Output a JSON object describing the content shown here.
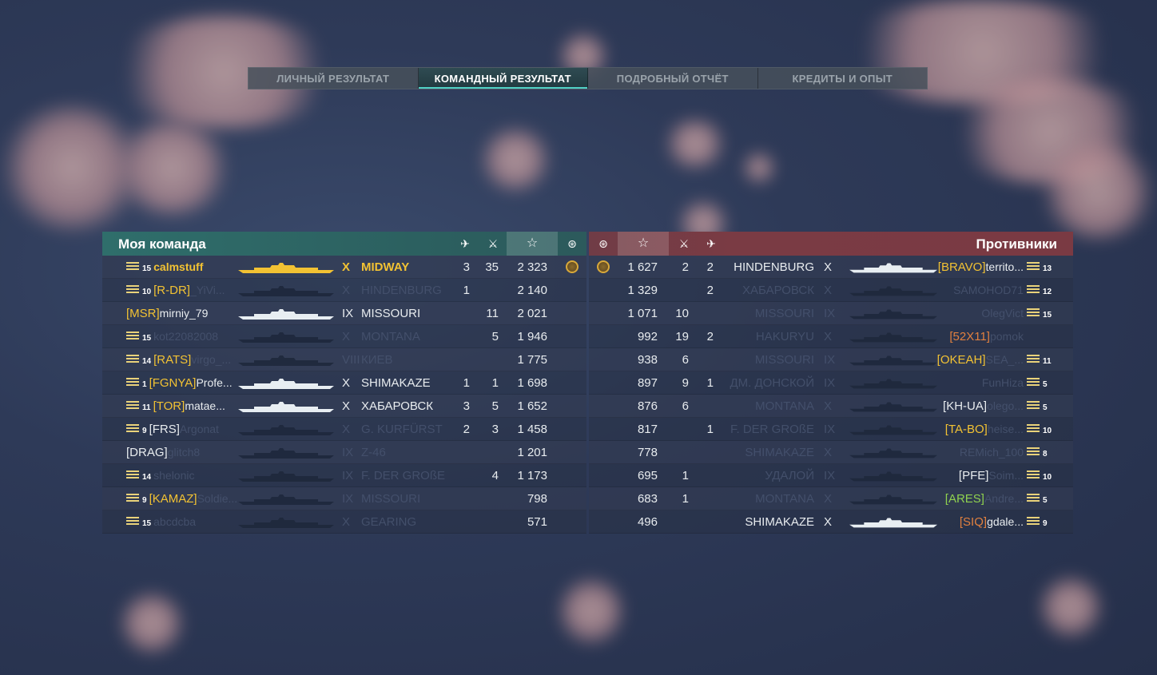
{
  "tabs": [
    {
      "label": "ЛИЧНЫЙ РЕЗУЛЬТАТ",
      "active": false
    },
    {
      "label": "КОМАНДНЫЙ РЕЗУЛЬТАТ",
      "active": true
    },
    {
      "label": "ПОДРОБНЫЙ ОТЧЁТ",
      "active": false
    },
    {
      "label": "КРЕДИТЫ И ОПЫТ",
      "active": false
    }
  ],
  "my_team": {
    "title": "Моя команда",
    "players": [
      {
        "rank": "15",
        "clan": "",
        "name": "calmstuff",
        "tier": "X",
        "ship": "MIDWAY",
        "planes": "3",
        "kills": "35",
        "xp": "2 323",
        "alive": true,
        "self": true
      },
      {
        "rank": "10",
        "clan": "[R-DR]",
        "name": "_YiVi...",
        "tier": "X",
        "ship": "HINDENBURG",
        "planes": "1",
        "kills": "",
        "xp": "2 140",
        "alive": false
      },
      {
        "rank": "",
        "clan": "[MSR]",
        "name": "mirniy_79",
        "tier": "IX",
        "ship": "MISSOURI",
        "planes": "",
        "kills": "11",
        "xp": "2 021",
        "alive": true
      },
      {
        "rank": "15",
        "clan": "",
        "name": "kot22082008",
        "tier": "X",
        "ship": "MONTANA",
        "planes": "",
        "kills": "5",
        "xp": "1 946",
        "alive": false
      },
      {
        "rank": "14",
        "clan": "[RATS]",
        "name": "virgo_...",
        "tier": "VIII",
        "ship": "КИЕВ",
        "planes": "",
        "kills": "",
        "xp": "1 775",
        "alive": false
      },
      {
        "rank": "1",
        "clan": "[FGNYA]",
        "name": "Profe...",
        "tier": "X",
        "ship": "SHIMAKAZE",
        "planes": "1",
        "kills": "1",
        "xp": "1 698",
        "alive": true
      },
      {
        "rank": "11",
        "clan": "[TOR]",
        "name": "matae...",
        "tier": "X",
        "ship": "ХАБАРОВСК",
        "planes": "3",
        "kills": "5",
        "xp": "1 652",
        "alive": true
      },
      {
        "rank": "9",
        "clan": "[FRS]",
        "name": "Argonat",
        "tier": "X",
        "ship": "G. KURFÜRST",
        "planes": "2",
        "kills": "3",
        "xp": "1 458",
        "alive": false
      },
      {
        "rank": "",
        "clan": "[DRAG]",
        "name": "glitch8",
        "tier": "IX",
        "ship": "Z-46",
        "planes": "",
        "kills": "",
        "xp": "1 201",
        "alive": false
      },
      {
        "rank": "14",
        "clan": "",
        "name": "shelonic",
        "tier": "IX",
        "ship": "F. DER GROßE",
        "planes": "",
        "kills": "4",
        "xp": "1 173",
        "alive": false
      },
      {
        "rank": "9",
        "clan": "[KAMAZ]",
        "name": "Soldie...",
        "tier": "IX",
        "ship": "MISSOURI",
        "planes": "",
        "kills": "",
        "xp": "798",
        "alive": false
      },
      {
        "rank": "15",
        "clan": "",
        "name": "abcdcba",
        "tier": "X",
        "ship": "GEARING",
        "planes": "",
        "kills": "",
        "xp": "571",
        "alive": false
      }
    ]
  },
  "enemy_team": {
    "title": "Противники",
    "players": [
      {
        "xp": "1 627",
        "kills": "2",
        "planes": "2",
        "ship": "HINDENBURG",
        "tier": "X",
        "clan": "[BRAVO]",
        "name": "territo...",
        "rank": "13",
        "alive": true
      },
      {
        "xp": "1 329",
        "kills": "",
        "planes": "2",
        "ship": "ХАБАРОВСК",
        "tier": "X",
        "clan": "",
        "name": "SAMOHOD71",
        "rank": "12",
        "alive": false
      },
      {
        "xp": "1 071",
        "kills": "10",
        "planes": "",
        "ship": "MISSOURI",
        "tier": "IX",
        "clan": "",
        "name": "OlegVict",
        "rank": "15",
        "alive": false
      },
      {
        "xp": "992",
        "kills": "19",
        "planes": "2",
        "ship": "HAKURYU",
        "tier": "X",
        "clan": "[52X11]",
        "name": "pomok",
        "rank": "",
        "alive": false
      },
      {
        "xp": "938",
        "kills": "6",
        "planes": "",
        "ship": "MISSOURI",
        "tier": "IX",
        "clan": "[OKEAH]",
        "name": "SEA_...",
        "rank": "11",
        "alive": false
      },
      {
        "xp": "897",
        "kills": "9",
        "planes": "1",
        "ship": "ДМ. ДОНСКОЙ",
        "tier": "IX",
        "clan": "",
        "name": "FunHiza",
        "rank": "5",
        "alive": false
      },
      {
        "xp": "876",
        "kills": "6",
        "planes": "",
        "ship": "MONTANA",
        "tier": "X",
        "clan": "[KH-UA]",
        "name": "olego...",
        "rank": "5",
        "alive": false
      },
      {
        "xp": "817",
        "kills": "",
        "planes": "1",
        "ship": "F. DER GROßE",
        "tier": "IX",
        "clan": "[TA-BO]",
        "name": "heise...",
        "rank": "10",
        "alive": false
      },
      {
        "xp": "778",
        "kills": "",
        "planes": "",
        "ship": "SHIMAKAZE",
        "tier": "X",
        "clan": "",
        "name": "REMich_100",
        "rank": "8",
        "alive": false
      },
      {
        "xp": "695",
        "kills": "1",
        "planes": "",
        "ship": "УДАЛОЙ",
        "tier": "IX",
        "clan": "[PFE]",
        "name": "Soim...",
        "rank": "10",
        "alive": false
      },
      {
        "xp": "683",
        "kills": "1",
        "planes": "",
        "ship": "MONTANA",
        "tier": "X",
        "clan": "[ARES]",
        "name": "Andre...",
        "rank": "5",
        "alive": false
      },
      {
        "xp": "496",
        "kills": "",
        "planes": "",
        "ship": "SHIMAKAZE",
        "tier": "X",
        "clan": "[SIQ]",
        "name": "gdale...",
        "rank": "9",
        "alive": true
      }
    ]
  },
  "icons": {
    "planes": "plane-icon",
    "kills": "crossed-swords-icon",
    "xp": "star-icon",
    "achievement": "medal-icon"
  },
  "colors": {
    "my_team_header": "#2f6e6b",
    "enemy_header": "#7a3b44",
    "gold": "#f2c233",
    "active_tab_accent": "#4fd1c5"
  }
}
